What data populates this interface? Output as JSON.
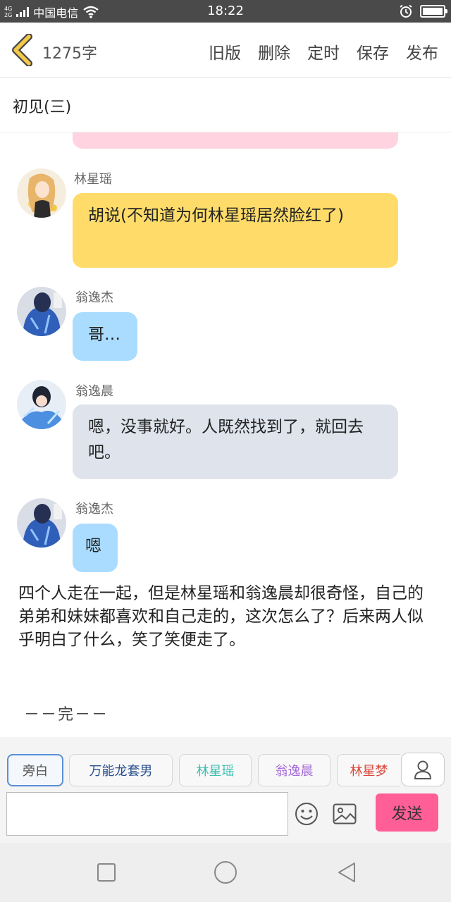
{
  "status_bar": {
    "network_top": "4G",
    "network_bottom": "2G",
    "carrier": "中国电信",
    "time": "18:22"
  },
  "header": {
    "word_count": "1275字",
    "actions": [
      "旧版",
      "删除",
      "定时",
      "保存",
      "发布"
    ]
  },
  "chapter_title": "初见(三)",
  "messages": [
    {
      "speaker": "林星瑶",
      "text": "胡说(不知道为何林星瑶居然脸红了)",
      "bubble_color": "#ffdc69"
    },
    {
      "speaker": "翁逸杰",
      "text": "哥…",
      "bubble_color": "#a9dcff"
    },
    {
      "speaker": "翁逸晨",
      "text": "嗯，没事就好。人既然找到了，就回去吧。",
      "bubble_color": "#dee3ec"
    },
    {
      "speaker": "翁逸杰",
      "text": "嗯",
      "bubble_color": "#a9dcff"
    }
  ],
  "narration": "四个人走在一起，但是林星瑶和翁逸晨却很奇怪，自己的弟弟和妹妹都喜欢和自己走的，这次怎么了？后来两人似乎明白了什么，笑了笑便走了。",
  "end_mark": "－－完－－",
  "roles": [
    {
      "label": "旁白",
      "color": "#555555"
    },
    {
      "label": "万能龙套男",
      "color": "#2a4f8f"
    },
    {
      "label": "林星瑶",
      "color": "#3cbfb0"
    },
    {
      "label": "翁逸晨",
      "color": "#a66ad9"
    },
    {
      "label": "林星梦",
      "color": "#d9463a"
    }
  ],
  "input": {
    "value": "",
    "send_label": "发送"
  },
  "colors": {
    "accent_back": "#f2c94c",
    "send": "#ff5e97",
    "previous_bubble": "#ffd3e0"
  }
}
